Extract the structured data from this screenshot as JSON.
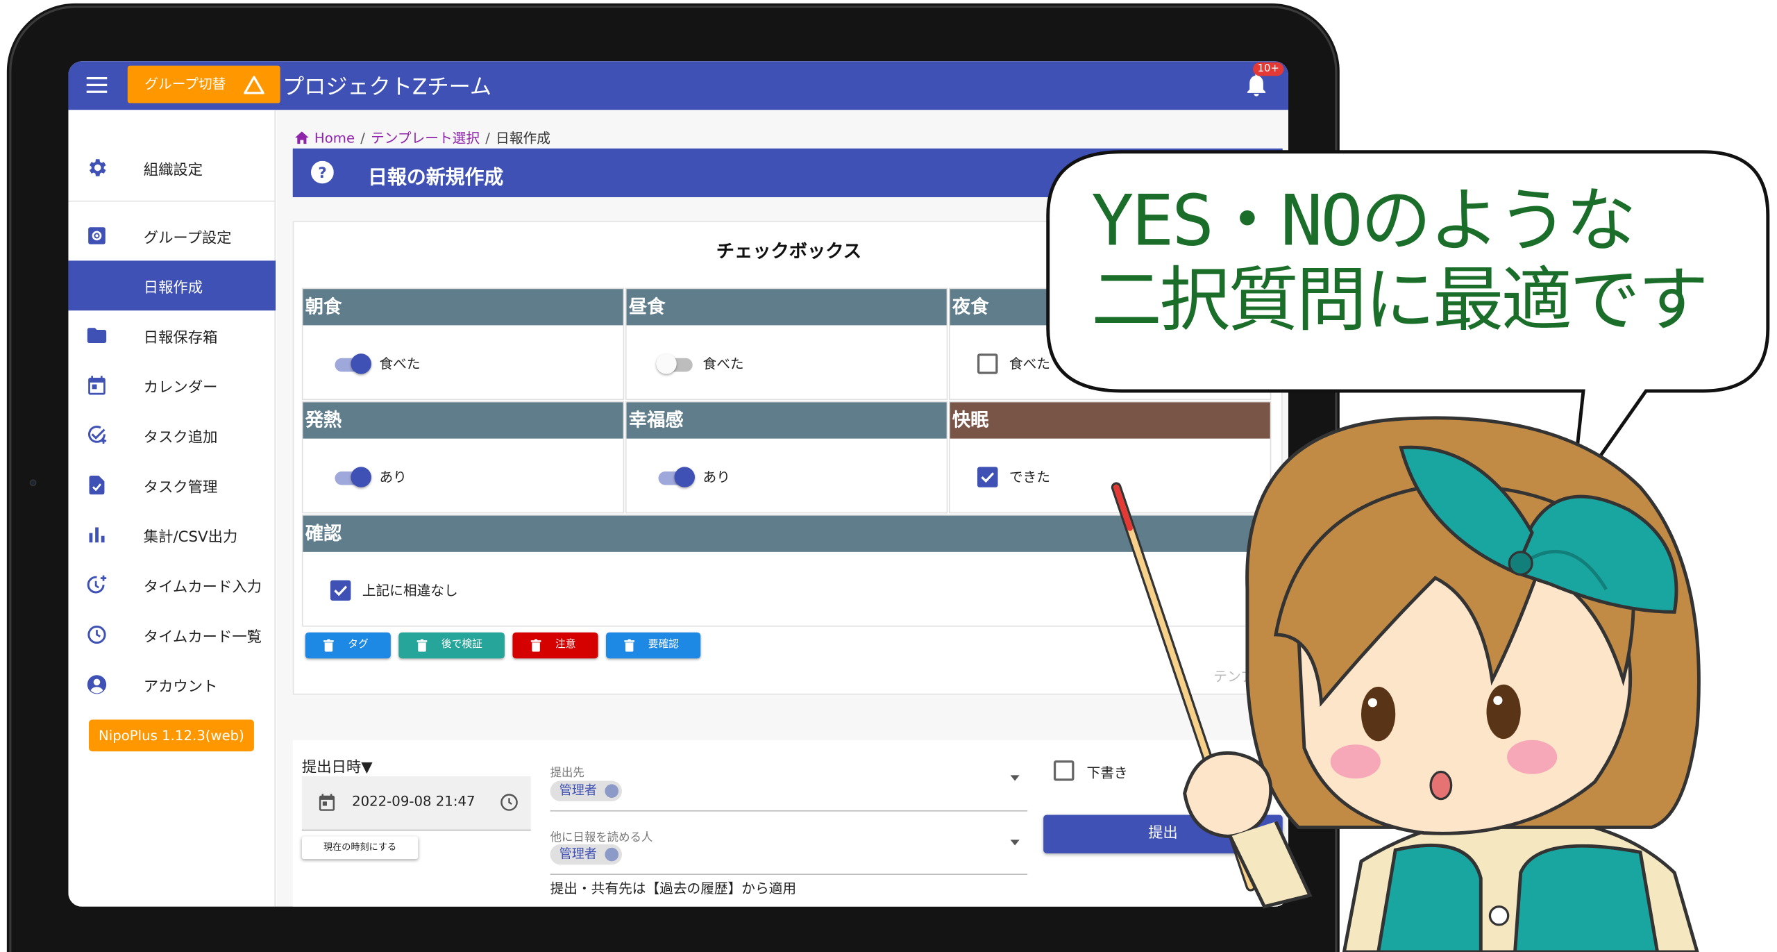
{
  "app": {
    "menu_icon": "menu-icon",
    "group_switch_label": "グループ切替",
    "team_name": "プロジェクトZチーム",
    "notification_badge": "10+"
  },
  "sidebar": {
    "items": [
      {
        "label": "組織設定",
        "icon": "gear-icon"
      },
      {
        "label": "グループ設定",
        "icon": "group-settings-icon"
      },
      {
        "label": "日報作成",
        "icon": "",
        "active": true
      },
      {
        "label": "日報保存箱",
        "icon": "folder-icon"
      },
      {
        "label": "カレンダー",
        "icon": "calendar-icon"
      },
      {
        "label": "タスク追加",
        "icon": "task-add-icon"
      },
      {
        "label": "タスク管理",
        "icon": "task-doc-icon"
      },
      {
        "label": "集計/CSV出力",
        "icon": "bar-chart-icon"
      },
      {
        "label": "タイムカード入力",
        "icon": "timecard-add-icon"
      },
      {
        "label": "タイムカード一覧",
        "icon": "clock-icon"
      },
      {
        "label": "アカウント",
        "icon": "account-icon"
      }
    ],
    "version": "NipoPlus 1.12.3(web)"
  },
  "breadcrumb": {
    "home": "Home",
    "template_select": "テンプレート選択",
    "current": "日報作成"
  },
  "page": {
    "title": "日報の新規作成"
  },
  "card": {
    "title": "チェックボックス",
    "fields": [
      {
        "header": "朝食",
        "control": "switch",
        "checked": true,
        "label": "食べた"
      },
      {
        "header": "昼食",
        "control": "switch",
        "checked": false,
        "label": "食べた"
      },
      {
        "header": "夜食",
        "control": "checkbox",
        "checked": false,
        "label": "食べた"
      },
      {
        "header": "発熱",
        "control": "switch",
        "checked": true,
        "label": "あり"
      },
      {
        "header": "幸福感",
        "control": "switch",
        "checked": true,
        "label": "あり"
      },
      {
        "header": "快眠",
        "control": "checkbox",
        "checked": true,
        "label": "できた"
      }
    ],
    "confirm": {
      "header": "確認",
      "checked": true,
      "label": "上記に相違なし"
    },
    "tags": [
      {
        "label": "タグ",
        "color": "#1e88e5"
      },
      {
        "label": "後で検証",
        "color": "#26a69a"
      },
      {
        "label": "注意",
        "color": "#d50000"
      },
      {
        "label": "要確認",
        "color": "#1e88e5"
      }
    ],
    "template_note": "テンプレ"
  },
  "form": {
    "submit_datetime_label": "提出日時▼",
    "datetime_value": "2022-09-08 21:47",
    "set_now_button": "現在の時刻にする",
    "submit_to_label": "提出先",
    "submit_to_chip": "管理者",
    "readers_label": "他に日報を読める人",
    "readers_chip": "管理者",
    "apply_note": "提出・共有先は【過去の履歴】から適用",
    "draft_label": "下書き",
    "draft_checked": false,
    "submit_button": "提出"
  },
  "bubble": {
    "line1": "YES・NOのような",
    "line2": "二択質問に最適です"
  },
  "colors": {
    "primary": "#3f51b5",
    "accent_orange": "#ff9800",
    "header_slate": "#607d8b",
    "header_brown": "#795548",
    "bubble_text": "#1b6e2a"
  }
}
